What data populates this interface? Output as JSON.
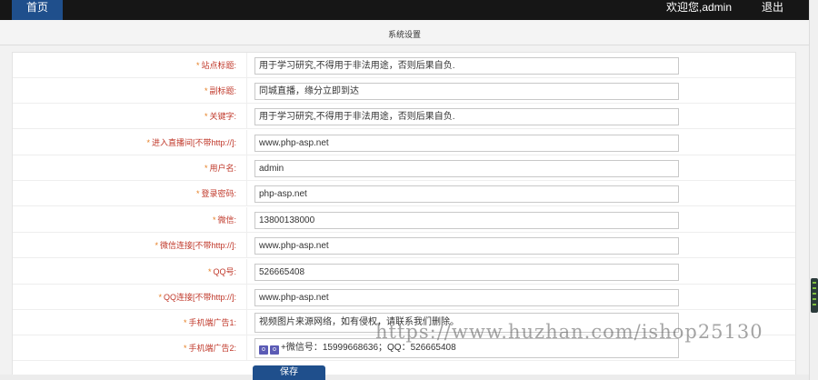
{
  "header": {
    "home_label": "首页",
    "welcome_text": "欢迎您,admin",
    "logout_label": "退出"
  },
  "page": {
    "title": "系统设置"
  },
  "form": {
    "rows": [
      {
        "label": "站点标题:",
        "value": "用于学习研究,不得用于非法用途，否则后果自负."
      },
      {
        "label": "副标题:",
        "value": "同城直播，缘分立即到达"
      },
      {
        "label": "关键字:",
        "value": "用于学习研究,不得用于非法用途，否则后果自负."
      },
      {
        "label": "进入直播间[不带http://]:",
        "value": "www.php-asp.net"
      },
      {
        "label": "用户名:",
        "value": "admin"
      },
      {
        "label": "登录密码:",
        "value": "php-asp.net"
      },
      {
        "label": "微信:",
        "value": "13800138000"
      },
      {
        "label": "微信连接[不带http://]:",
        "value": "www.php-asp.net"
      },
      {
        "label": "QQ号:",
        "value": "526665408"
      },
      {
        "label": "QQ连接[不带http://]:",
        "value": "www.php-asp.net"
      },
      {
        "label": "手机端广告1:",
        "value": "视频图片来源网络，如有侵权，请联系我们删除。"
      },
      {
        "label": "手机端广告2:",
        "value": "+微信号：15999668636；QQ：526665408"
      }
    ],
    "ad2_icons": [
      "o",
      "o",
      "Q"
    ],
    "save_label": "保存"
  },
  "watermark": "https://www.huzhan.com/ishop25130",
  "colors": {
    "topbar": "#161616",
    "accent": "#1f4f8c",
    "label": "#c0392b",
    "required_star": "#e67e22"
  }
}
